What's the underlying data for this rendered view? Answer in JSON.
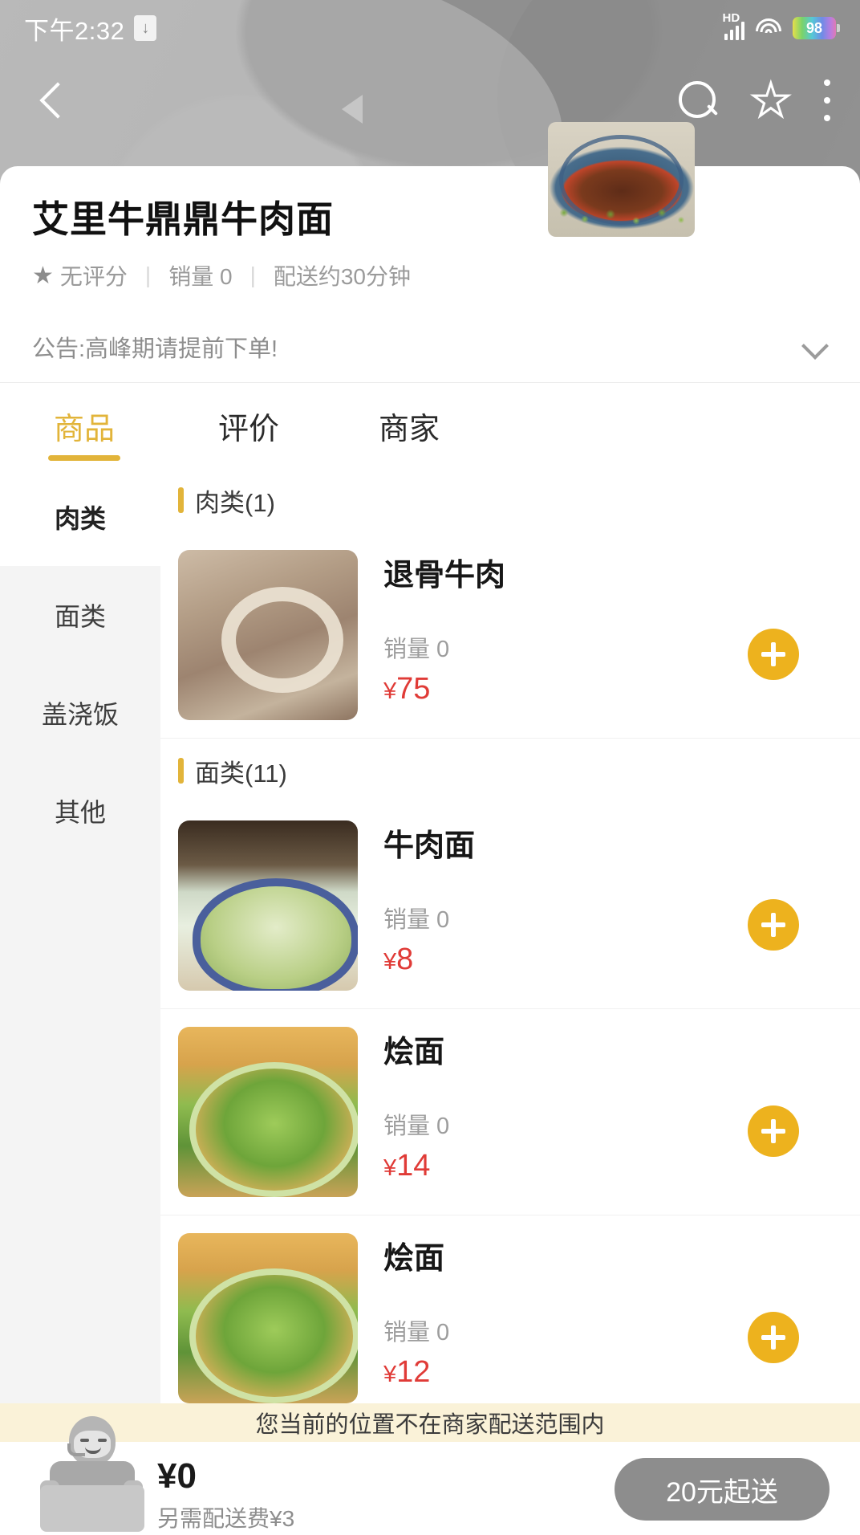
{
  "status_bar": {
    "time": "下午2:32",
    "download_icon": "download-icon",
    "hd_label": "HD",
    "signal_icon": "signal-icon",
    "wifi_icon": "wifi-icon",
    "battery_level": "98"
  },
  "nav": {
    "back_icon": "back-arrow-icon",
    "search_icon": "search-icon",
    "favorite_icon": "star-icon",
    "more_icon": "more-vertical-icon"
  },
  "shop": {
    "name": "艾里牛鼎鼎牛肉面",
    "rating": "无评分",
    "sales": "销量 0",
    "delivery_time": "配送约30分钟",
    "notice": "公告:高峰期请提前下单!",
    "notice_expand_icon": "chevron-down-icon",
    "thumbnail": "shop-thumbnail"
  },
  "tabs": [
    {
      "label": "商品",
      "active": true
    },
    {
      "label": "评价",
      "active": false
    },
    {
      "label": "商家",
      "active": false
    }
  ],
  "sidebar": {
    "items": [
      {
        "label": "肉类",
        "active": true
      },
      {
        "label": "面类",
        "active": false
      },
      {
        "label": "盖浇饭",
        "active": false
      },
      {
        "label": "其他",
        "active": false
      }
    ]
  },
  "sections": [
    {
      "title": "肉类(1)",
      "items": [
        {
          "name": "退骨牛肉",
          "sold": "销量 0",
          "currency": "¥",
          "price": "75",
          "add_icon": "plus-icon"
        }
      ]
    },
    {
      "title": "面类(11)",
      "items": [
        {
          "name": "牛肉面",
          "sold": "销量 0",
          "currency": "¥",
          "price": "8",
          "add_icon": "plus-icon"
        },
        {
          "name": "烩面",
          "sold": "销量 0",
          "currency": "¥",
          "price": "14",
          "add_icon": "plus-icon"
        },
        {
          "name": "烩面",
          "sold": "销量 0",
          "currency": "¥",
          "price": "12",
          "add_icon": "plus-icon"
        }
      ]
    }
  ],
  "warning": {
    "text": "您当前的位置不在商家配送范围内"
  },
  "cart": {
    "courier_icon": "courier-avatar-icon",
    "total": "¥0",
    "delivery_fee": "另需配送费¥3",
    "order_button": "20元起送"
  },
  "colors": {
    "accent": "#E2B43A",
    "price": "#E03B37",
    "add_button": "#EDB21E",
    "warning_bg": "#FAF2D8",
    "order_button": "#8D8D8D"
  }
}
